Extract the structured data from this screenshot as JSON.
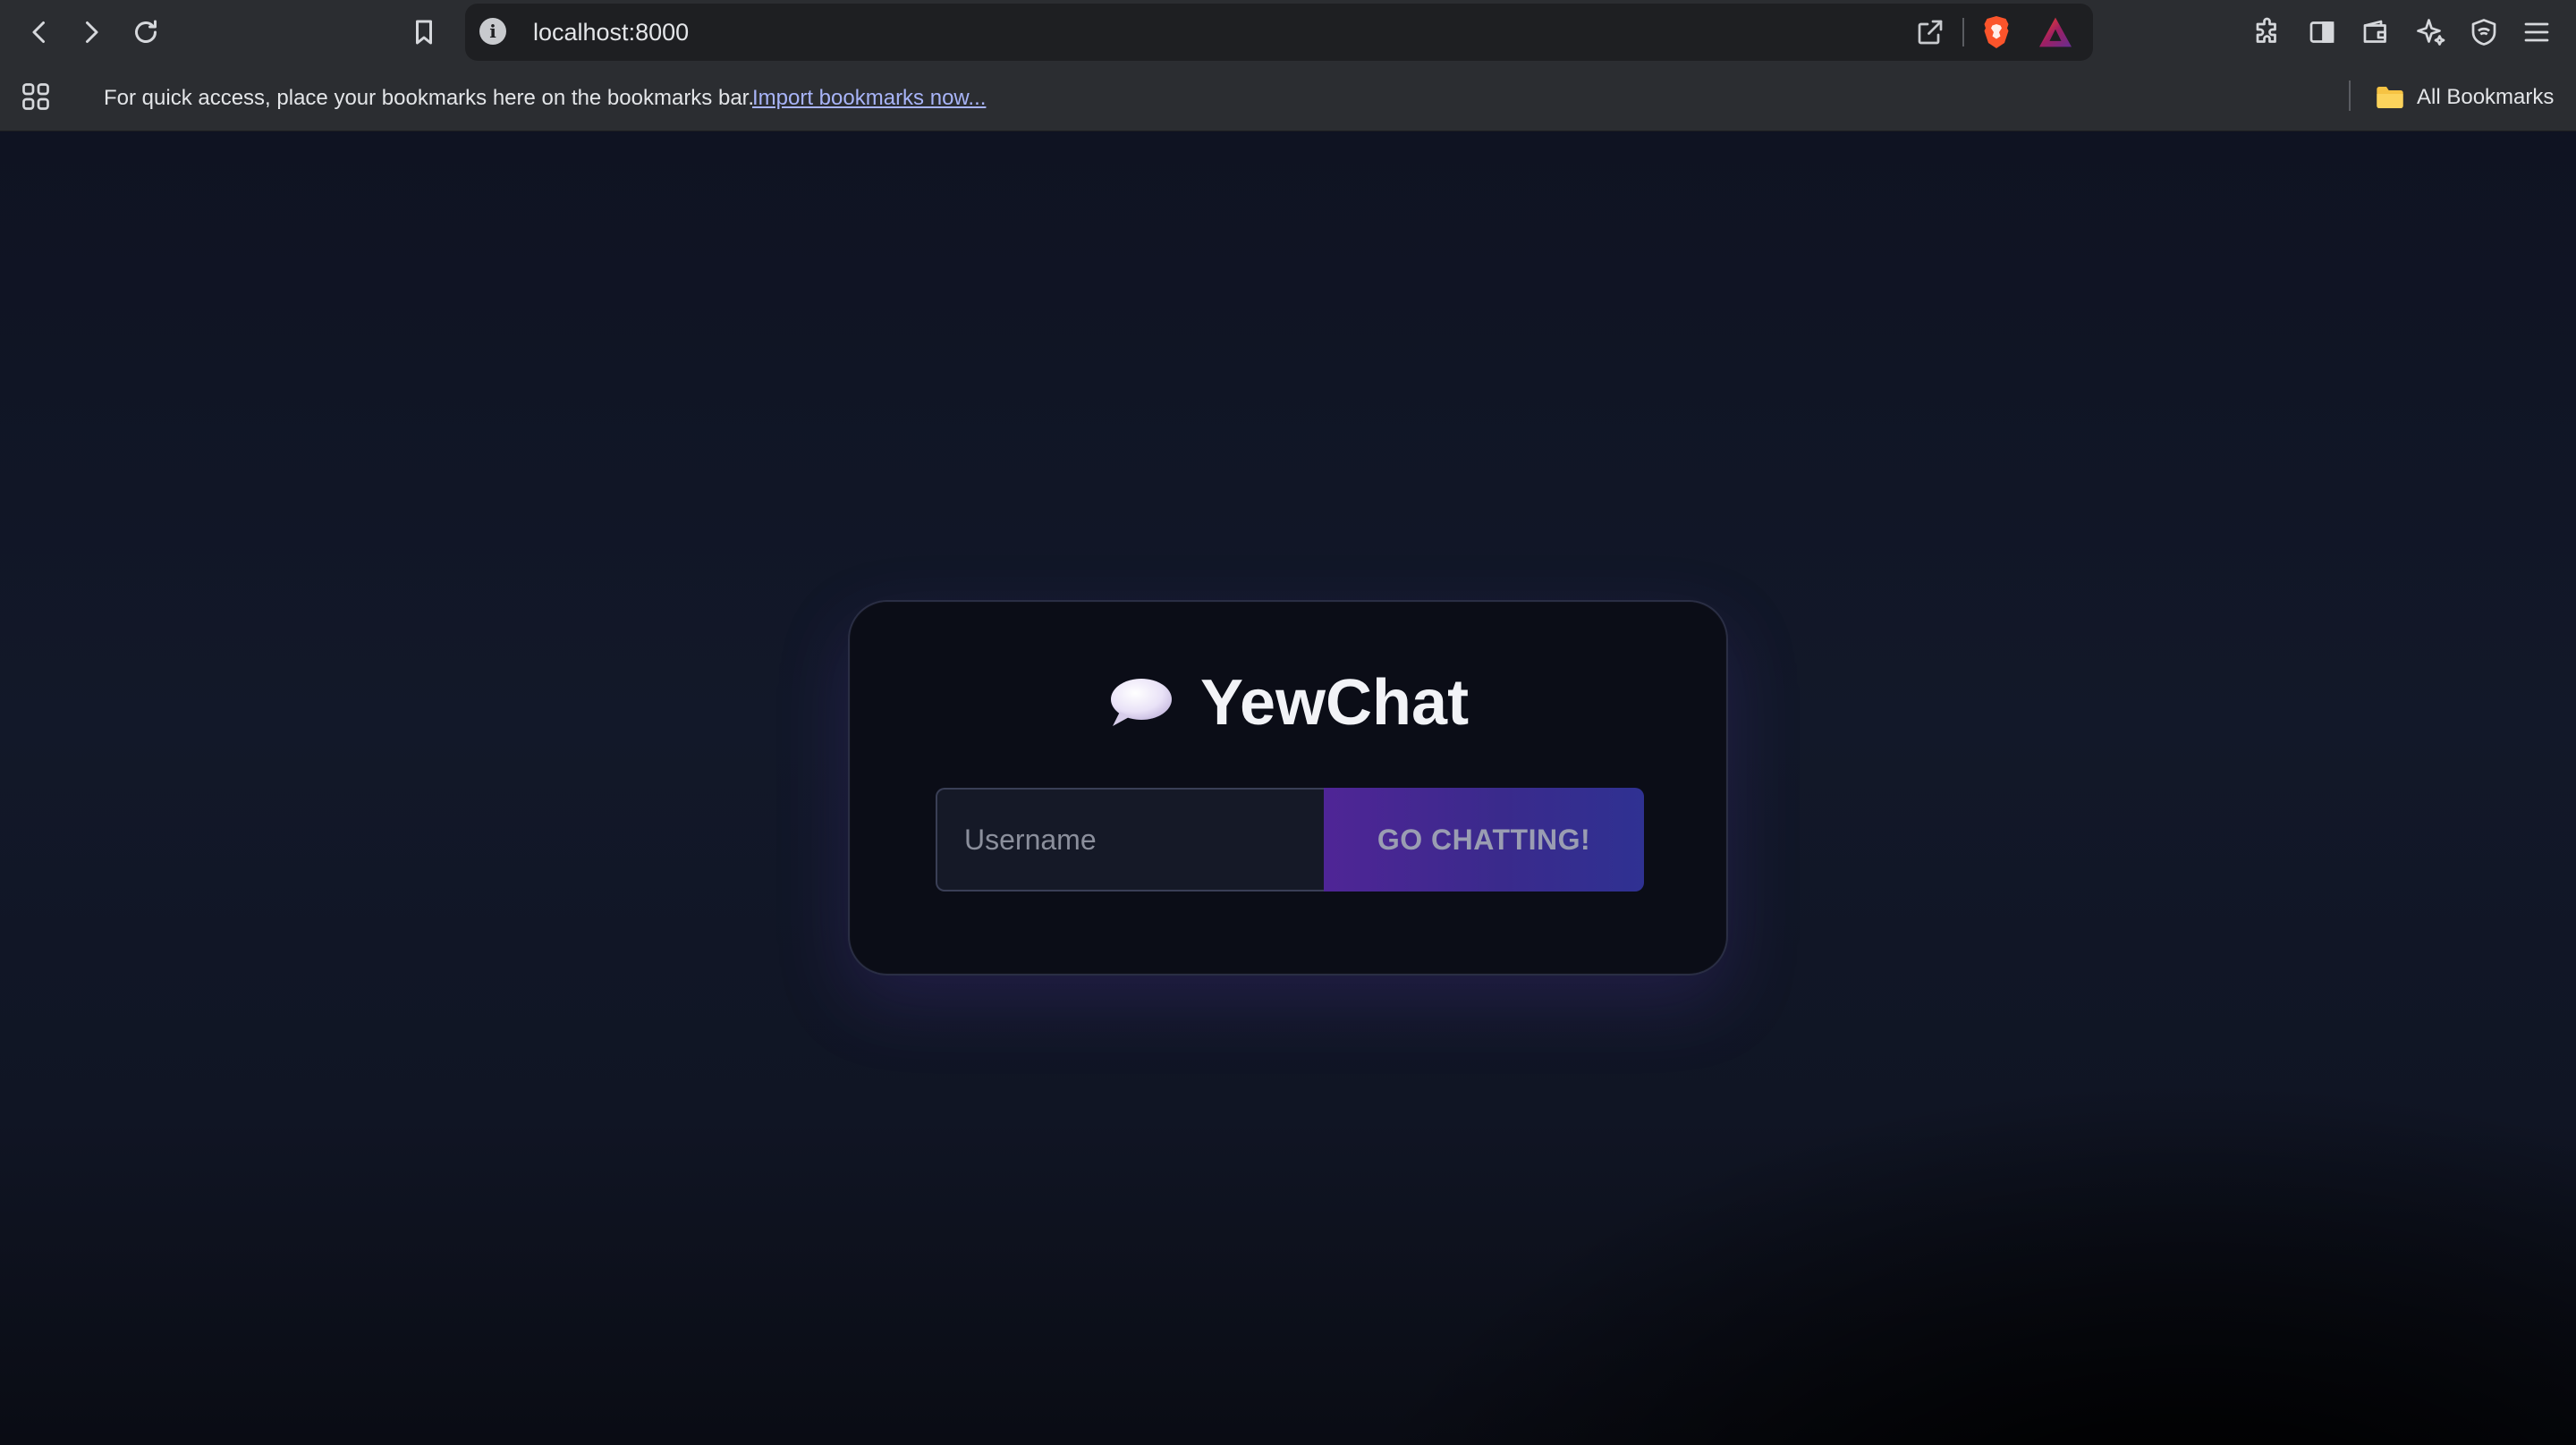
{
  "browser": {
    "url": "localhost:8000",
    "info_glyph": "i",
    "bookmarks_bar": {
      "message": "For quick access, place your bookmarks here on the bookmarks bar.",
      "import_link": "Import bookmarks now...",
      "all_bookmarks": "All Bookmarks"
    }
  },
  "app": {
    "title": "YewChat",
    "icon": "speech-bubble-icon",
    "username_placeholder": "Username",
    "username_value": "",
    "submit_label": "GO CHATTING!"
  },
  "colors": {
    "browser_chrome": "#2b2d31",
    "page_background": "#0f1320",
    "card_background": "#0b0d17",
    "button_gradient_start": "#4f2596",
    "button_gradient_end": "#2f3192",
    "link": "#a8b4f8"
  }
}
